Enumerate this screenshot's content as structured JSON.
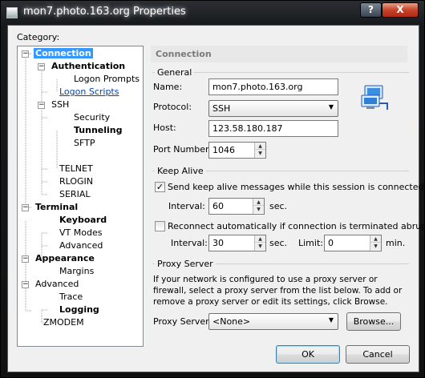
{
  "window": {
    "title": "mon7.photo.163.org Properties",
    "help_label": "?",
    "close_label": "X"
  },
  "category_label": "Category:",
  "tree": [
    {
      "label": "Connection",
      "expander": "−"
    },
    {
      "label": "Authentication",
      "expander": "−"
    },
    {
      "label": "Logon Prompts"
    },
    {
      "label": "Logon Scripts"
    },
    {
      "label": "SSH",
      "expander": "−"
    },
    {
      "label": "Security"
    },
    {
      "label": "Tunneling"
    },
    {
      "label": "SFTP"
    },
    {
      "label": "TELNET"
    },
    {
      "label": "RLOGIN"
    },
    {
      "label": "SERIAL"
    },
    {
      "label": "Terminal",
      "expander": "−"
    },
    {
      "label": "Keyboard"
    },
    {
      "label": "VT Modes"
    },
    {
      "label": "Advanced"
    },
    {
      "label": "Appearance",
      "expander": "−"
    },
    {
      "label": "Margins"
    },
    {
      "label": "Advanced",
      "expander": "−"
    },
    {
      "label": "Trace"
    },
    {
      "label": "Logging"
    },
    {
      "label": "ZMODEM"
    }
  ],
  "section_title": "Connection",
  "general": {
    "title": "General",
    "name_label": "Name:",
    "name_value": "mon7.photo.163.org",
    "protocol_label": "Protocol:",
    "protocol_value": "SSH",
    "host_label": "Host:",
    "host_value": "123.58.180.187",
    "port_label": "Port Number:",
    "port_value": "1046"
  },
  "keep_alive": {
    "title": "Keep Alive",
    "send_label": "Send keep alive messages while this session is connected",
    "send_checked": "✓",
    "interval_label": "Interval:",
    "interval_value": "60",
    "interval_unit": "sec.",
    "reconnect_label": "Reconnect automatically if connection is terminated abruptly",
    "reconnect_checked": "",
    "reconnect_interval_label": "Interval:",
    "reconnect_interval_value": "30",
    "reconnect_interval_unit": "sec.",
    "limit_label": "Limit:",
    "limit_value": "0",
    "limit_unit": "min."
  },
  "proxy": {
    "title": "Proxy Server",
    "description": "If your network is configured to use a proxy server or firewall, select a proxy server from the list below. To add or remove a proxy server or edit its settings, click Browse.",
    "label": "Proxy Server:",
    "value": "<None>",
    "browse_label": "Browse..."
  },
  "buttons": {
    "ok": "OK",
    "cancel": "Cancel"
  },
  "colors": {
    "selection": "#3399ff",
    "link": "#0645ad",
    "close": "#c7432a"
  }
}
